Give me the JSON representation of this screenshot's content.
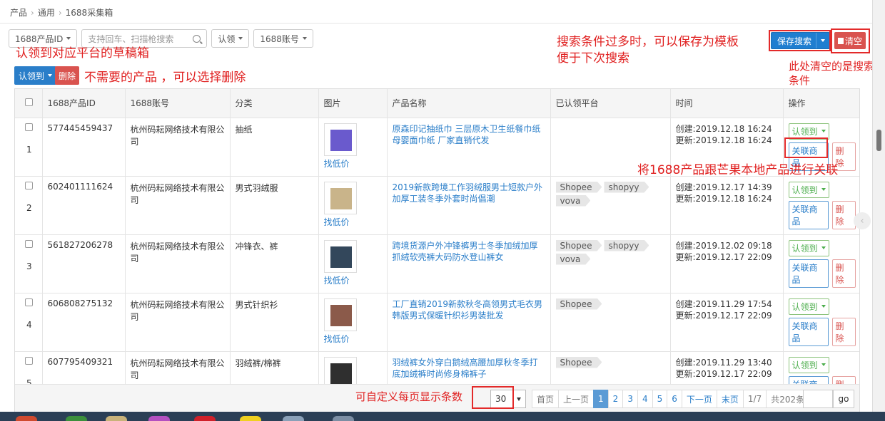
{
  "breadcrumb": {
    "items": [
      "产品",
      "通用",
      "1688采集箱"
    ]
  },
  "filters": {
    "product_id_select": "1688产品ID",
    "search_placeholder": "支持回车、扫描枪搜索",
    "claim_select": "认领",
    "account_select": "1688账号"
  },
  "toolbar": {
    "save_search": "保存搜索",
    "clear": "清空",
    "claim_to": "认领到",
    "delete": "删除"
  },
  "annotations": {
    "claim": "认领到对应平台的草稿箱",
    "delete": "不需要的产品 ，可以选择删除",
    "save_line1": "搜索条件过多时，可以保存为模板",
    "save_line2": "便于下次搜索",
    "clear_line1": "此处清空的是搜索",
    "clear_line2": "条件",
    "link": "将1688产品跟芒果本地产品进行关联",
    "pagesize": "可自定义每页显示条数"
  },
  "table": {
    "headers": [
      "1688产品ID",
      "1688账号",
      "分类",
      "图片",
      "产品名称",
      "已认领平台",
      "时间",
      "操作"
    ],
    "low_price": "找低价",
    "op_claim": "认领到",
    "op_link": "关联商品",
    "op_delete": "删除",
    "rows": [
      {
        "num": "1",
        "id": "577445459437",
        "account": "杭州码耘网络技术有限公司",
        "category": "抽纸",
        "name": "原森印记抽纸巾 三层原木卫生纸餐巾纸母婴面巾纸 厂家直销代发",
        "platforms": [],
        "created": "创建:2019.12.18 16:24",
        "updated": "更新:2019.12.18 16:24",
        "img_color": "#6a5acd"
      },
      {
        "num": "2",
        "id": "602401111624",
        "account": "杭州码耘网络技术有限公司",
        "category": "男式羽绒服",
        "name": "2019新款跨境工作羽绒服男士短款户外加厚工装冬季外套时尚倡潮",
        "platforms": [
          "Shopee",
          "shopyy",
          "vova"
        ],
        "created": "创建:2019.12.17 14:39",
        "updated": "更新:2019.12.18 16:24",
        "img_color": "#c9b48a"
      },
      {
        "num": "3",
        "id": "561827206278",
        "account": "杭州码耘网络技术有限公司",
        "category": "冲锋衣、裤",
        "name": "跨境货源户外冲锋裤男士冬季加绒加厚抓绒软壳裤大码防水登山裤女",
        "platforms": [
          "Shopee",
          "shopyy",
          "vova"
        ],
        "created": "创建:2019.12.02 09:18",
        "updated": "更新:2019.12.17 22:09",
        "img_color": "#33475b"
      },
      {
        "num": "4",
        "id": "606808275132",
        "account": "杭州码耘网络技术有限公司",
        "category": "男式针织衫",
        "name": "工厂直销2019新款秋冬高领男式毛衣男韩版男式保暖针织衫男装批发",
        "platforms": [
          "Shopee"
        ],
        "created": "创建:2019.11.29 17:54",
        "updated": "更新:2019.12.17 22:09",
        "img_color": "#8b5a4a"
      },
      {
        "num": "5",
        "id": "607795409321",
        "account": "杭州码耘网络技术有限公司",
        "category": "羽绒裤/棉裤",
        "name": "羽绒裤女外穿白鹅绒高腰加厚秋冬季打底加绒裤时尚修身棉裤子",
        "platforms": [
          "Shopee"
        ],
        "created": "创建:2019.11.29 13:40",
        "updated": "更新:2019.12.17 22:09",
        "img_color": "#2f2f2f"
      }
    ]
  },
  "pager": {
    "page_size": "30",
    "first": "首页",
    "prev": "上一页",
    "pages": [
      "1",
      "2",
      "3",
      "4",
      "5",
      "6"
    ],
    "current": "1",
    "next": "下一页",
    "last": "末页",
    "page_info": "1/7",
    "total": "共202条",
    "go": "go"
  }
}
